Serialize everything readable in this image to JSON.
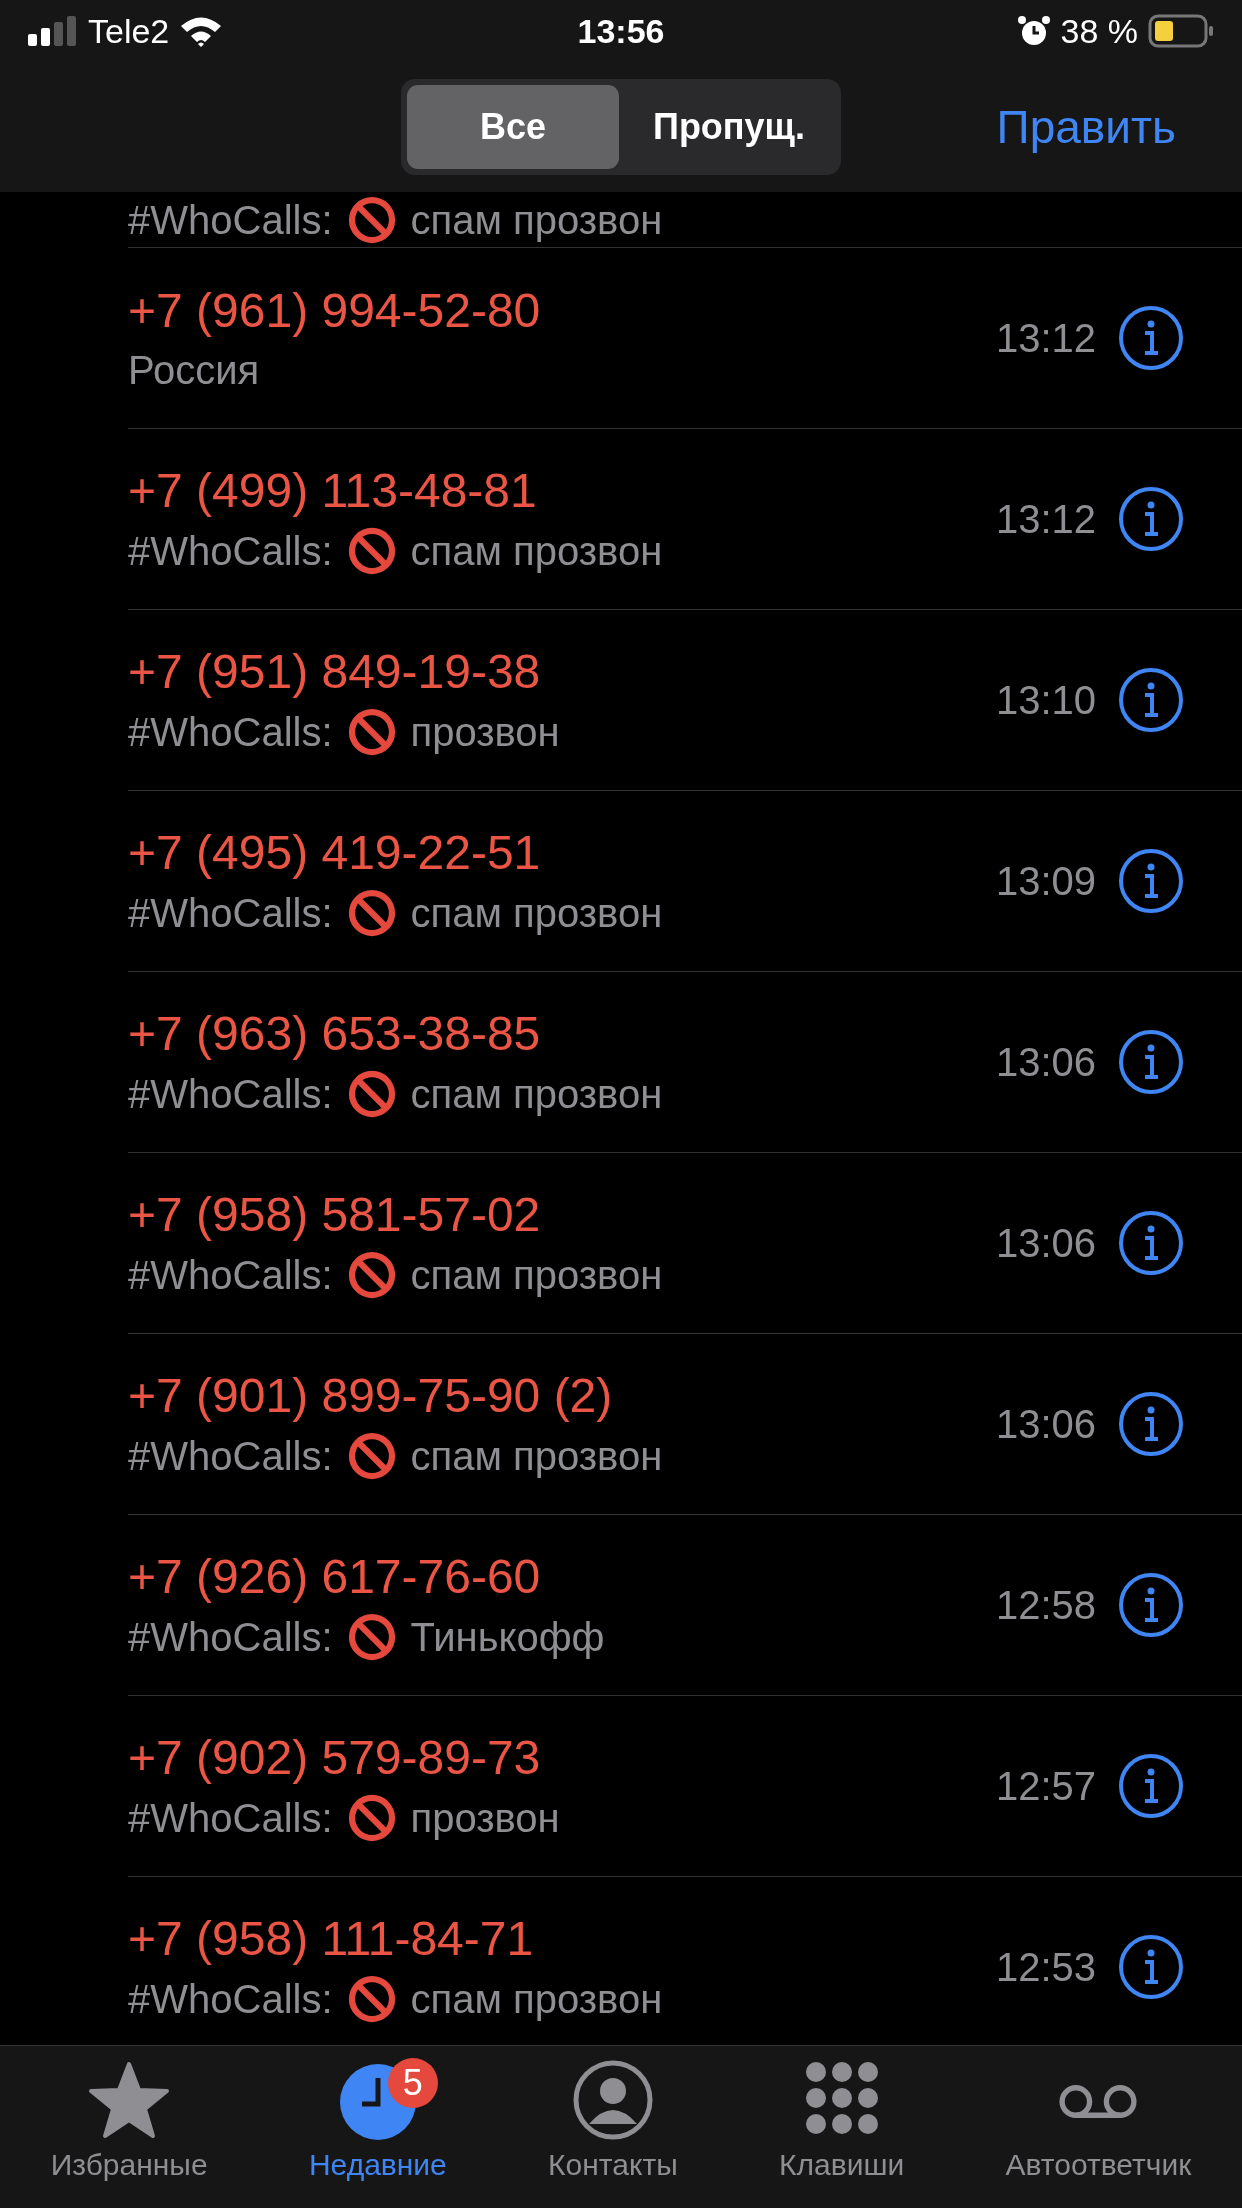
{
  "status_bar": {
    "carrier": "Tele2",
    "time": "13:56",
    "battery": "38 %"
  },
  "header": {
    "segments": [
      {
        "label": "Все",
        "selected": true
      },
      {
        "label": "Пропущ.",
        "selected": false
      }
    ],
    "edit": "Править"
  },
  "partial_row": {
    "tag": "#WhoCalls:",
    "label": "спам прозвон"
  },
  "calls": [
    {
      "number": "+7 (961) 994-52-80",
      "kind": "plain",
      "subtitle": "Россия",
      "time": "13:12"
    },
    {
      "number": "+7 (499) 113-48-81",
      "kind": "tagged",
      "tag": "#WhoCalls:",
      "subtitle": "спам прозвон",
      "time": "13:12"
    },
    {
      "number": "+7 (951) 849-19-38",
      "kind": "tagged",
      "tag": "#WhoCalls:",
      "subtitle": "прозвон",
      "time": "13:10"
    },
    {
      "number": "+7 (495) 419-22-51",
      "kind": "tagged",
      "tag": "#WhoCalls:",
      "subtitle": "спам прозвон",
      "time": "13:09"
    },
    {
      "number": "+7 (963) 653-38-85",
      "kind": "tagged",
      "tag": "#WhoCalls:",
      "subtitle": "спам прозвон",
      "time": "13:06"
    },
    {
      "number": "+7 (958) 581-57-02",
      "kind": "tagged",
      "tag": "#WhoCalls:",
      "subtitle": "спам прозвон",
      "time": "13:06"
    },
    {
      "number": "+7 (901) 899-75-90 (2)",
      "kind": "tagged",
      "tag": "#WhoCalls:",
      "subtitle": "спам прозвон",
      "time": "13:06"
    },
    {
      "number": "+7 (926) 617-76-60",
      "kind": "tagged",
      "tag": "#WhoCalls:",
      "subtitle": "Тинькофф",
      "time": "12:58"
    },
    {
      "number": "+7 (902) 579-89-73",
      "kind": "tagged",
      "tag": "#WhoCalls:",
      "subtitle": "прозвон",
      "time": "12:57"
    },
    {
      "number": "+7 (958) 111-84-71",
      "kind": "tagged",
      "tag": "#WhoCalls:",
      "subtitle": "спам прозвон",
      "time": "12:53"
    }
  ],
  "tab_bar": [
    {
      "kind": "star",
      "label": "Избранные",
      "selected": false
    },
    {
      "kind": "clock",
      "label": "Недавние",
      "selected": true,
      "badge": "5"
    },
    {
      "kind": "person",
      "label": "Контакты",
      "selected": false
    },
    {
      "kind": "keypad",
      "label": "Клавиши",
      "selected": false
    },
    {
      "kind": "voicemail",
      "label": "Автоответчик",
      "selected": false
    }
  ]
}
